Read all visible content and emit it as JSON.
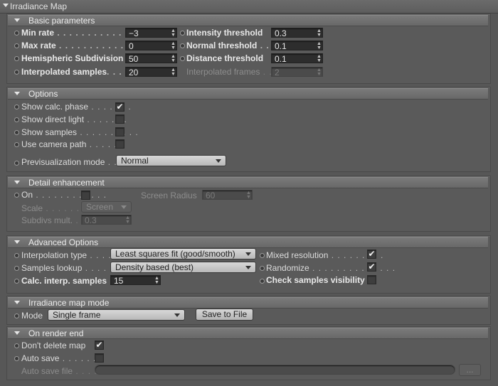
{
  "window": {
    "title": "Irradiance Map"
  },
  "sections": {
    "basic": {
      "title": "Basic parameters"
    },
    "options": {
      "title": "Options"
    },
    "detail": {
      "title": "Detail enhancement"
    },
    "advanced": {
      "title": "Advanced Options"
    },
    "mode": {
      "title": "Irradiance map mode"
    },
    "render_end": {
      "title": "On render end"
    }
  },
  "basic": {
    "min_rate": {
      "label": "Min rate",
      "dots": " . . . . . . . . . . . . . . .",
      "value": "−3"
    },
    "max_rate": {
      "label": "Max rate",
      "dots": " . . . . . . . . . . . . . . .",
      "value": "0"
    },
    "hsph": {
      "label": "Hemispheric Subdivision",
      "value": "50"
    },
    "interp_samples": {
      "label": "Interpolated samples",
      "dots": ". . . .",
      "value": "20"
    },
    "intensity": {
      "label": "Intensity threshold",
      "value": "0.3"
    },
    "normal": {
      "label": "Normal threshold",
      "dots": " . .",
      "value": "0.1"
    },
    "distance": {
      "label": "Distance threshold",
      "value": "0.1"
    },
    "interp_frames": {
      "label": "Interpolated frames",
      "dots": " . .",
      "value": "2"
    }
  },
  "options": {
    "show_calc": {
      "label": "Show calc. phase",
      "dots": " . . . . . . .",
      "checked": "✔"
    },
    "show_direct": {
      "label": "Show direct light",
      "dots": " . . . . . . .",
      "checked": ""
    },
    "show_samples": {
      "label": "Show samples",
      "dots": " . . . . . . . . . .",
      "checked": ""
    },
    "camera_path": {
      "label": "Use camera path",
      "dots": " . . . . . .",
      "checked": ""
    },
    "previs": {
      "label": "Previsualization mode",
      "dots": " . . .",
      "value": "Normal"
    }
  },
  "detail": {
    "on": {
      "label": "On",
      "dots": " . . . . . . . . . . . .",
      "checked": ""
    },
    "screen_radius": {
      "label": "Screen Radius",
      "value": "60"
    },
    "scale": {
      "label": "Scale",
      "dots": " . . . . . . . . . .",
      "value": "Screen"
    },
    "subdivs": {
      "label": "Subdivs mult.",
      "dots": " . . .",
      "value": "0.3"
    }
  },
  "advanced": {
    "interp_type": {
      "label": "Interpolation type",
      "dots": " . . . . .",
      "value": "Least squares fit (good/smooth)"
    },
    "samples_lookup": {
      "label": "Samples lookup",
      "dots": " . . . . . .",
      "value": "Density based (best)"
    },
    "calc_interp": {
      "label": "Calc. interp. samples",
      "value": "15"
    },
    "mixed_res": {
      "label": "Mixed resolution",
      "dots": " . . . . . . . . .",
      "checked": "✔"
    },
    "randomize": {
      "label": "Randomize",
      "dots": " . . . . . . . . . . . . . .",
      "checked": "✔"
    },
    "check_vis": {
      "label": "Check samples visibility",
      "checked": ""
    }
  },
  "mode": {
    "label": "Mode",
    "value": "Single frame",
    "save_button": "Save to File"
  },
  "render_end": {
    "dont_delete": {
      "label": "Don't delete map",
      "checked": "✔"
    },
    "auto_save": {
      "label": "Auto save",
      "dots": " . . . . . . .",
      "checked": ""
    },
    "auto_save_file": {
      "label": "Auto save file",
      "dots": " . . . .",
      "value": "",
      "browse": "..."
    }
  }
}
